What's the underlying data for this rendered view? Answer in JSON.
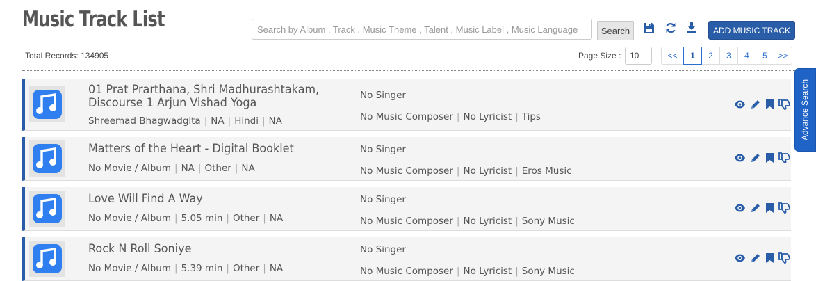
{
  "page": {
    "title": "Music Track List"
  },
  "search": {
    "placeholder": "Search by Album , Track , Music Theme , Talent , Music Label , Music Language",
    "value": "",
    "button_label": "Search"
  },
  "toolbar": {
    "icons": [
      "save-icon",
      "refresh-icon",
      "download-icon"
    ],
    "add_label": "ADD MUSIC TRACK"
  },
  "summary": {
    "total_records": "Total Records: 134905"
  },
  "pagination": {
    "page_size_label": "Page Size :",
    "page_size": "10",
    "first": "<<",
    "pages": [
      "1",
      "2",
      "3",
      "4",
      "5"
    ],
    "current": "1",
    "last": ">>"
  },
  "side_tab": {
    "label": "Advance Search"
  },
  "colors": {
    "accent": "#2a5da8",
    "note_icon": "#2f7ff0",
    "tab": "#1f63c7"
  },
  "tracks": [
    {
      "title": "01 Prat Prarthana, Shri Madhurashtakam, Discourse 1 Arjun Vishad Yoga",
      "album": "Shreemad Bhagwadgita",
      "duration": "NA",
      "language": "Hindi",
      "extra": "NA",
      "singer": "No Singer",
      "composer": "No Music Composer",
      "lyricist": "No Lyricist",
      "label": "Tips"
    },
    {
      "title": "Matters of the Heart - Digital Booklet",
      "album": "No Movie / Album",
      "duration": "NA",
      "language": "Other",
      "extra": "NA",
      "singer": "No Singer",
      "composer": "No Music Composer",
      "lyricist": "No Lyricist",
      "label": "Eros Music"
    },
    {
      "title": "Love Will Find A Way",
      "album": "No Movie / Album",
      "duration": "5.05 min",
      "language": "Other",
      "extra": "NA",
      "singer": "No Singer",
      "composer": "No Music Composer",
      "lyricist": "No Lyricist",
      "label": "Sony Music"
    },
    {
      "title": "Rock N Roll Soniye",
      "album": "No Movie / Album",
      "duration": "5.39 min",
      "language": "Other",
      "extra": "NA",
      "singer": "No Singer",
      "composer": "No Music Composer",
      "lyricist": "No Lyricist",
      "label": "Sony Music"
    }
  ],
  "row_actions": [
    "view-icon",
    "edit-icon",
    "bookmark-icon",
    "dislike-icon"
  ]
}
